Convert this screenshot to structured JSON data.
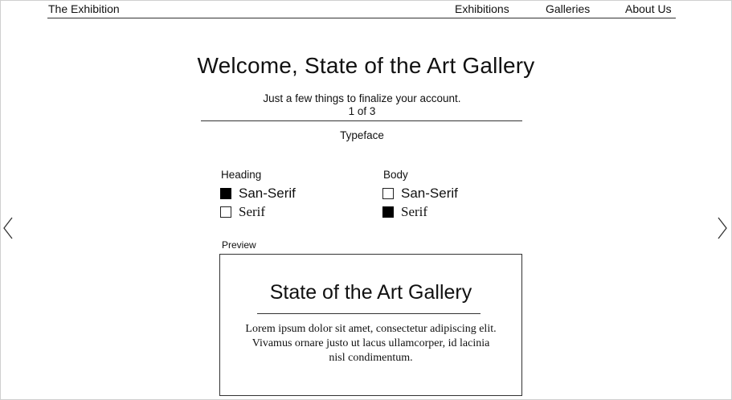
{
  "nav": {
    "brand": "The Exhibition",
    "links": [
      "Exhibitions",
      "Galleries",
      "About Us"
    ]
  },
  "welcome": {
    "title": "Welcome, State of the Art Gallery",
    "subtitle": "Just a few things to finalize your account.",
    "step": "1 of 3",
    "section": "Typeface"
  },
  "heading_group": {
    "label": "Heading",
    "options": [
      {
        "label": "San-Serif",
        "checked": true
      },
      {
        "label": "Serif",
        "checked": false
      }
    ]
  },
  "body_group": {
    "label": "Body",
    "options": [
      {
        "label": "San-Serif",
        "checked": false
      },
      {
        "label": "Serif",
        "checked": true
      }
    ]
  },
  "preview": {
    "label": "Preview",
    "title": "State of the Art Gallery",
    "body": "Lorem ipsum dolor sit amet, consectetur adipiscing elit. Vivamus ornare justo ut lacus ullamcorper, id lacinia nisl condimentum."
  },
  "icons": {
    "prev": "chevron-left-icon",
    "next": "chevron-right-icon"
  }
}
